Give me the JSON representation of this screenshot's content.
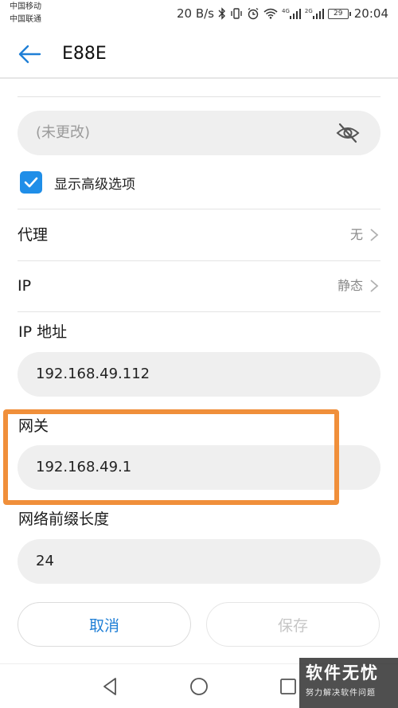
{
  "status_bar": {
    "carrier_1": "中国移动",
    "carrier_2": "中国联通",
    "net_speed": "20 B/s",
    "net_4g": "4G",
    "net_2g": "2G",
    "battery": "29",
    "time": "20:04"
  },
  "app_bar": {
    "title": "E88E"
  },
  "password": {
    "placeholder": "(未更改)"
  },
  "advanced": {
    "label": "显示高级选项",
    "checked": true
  },
  "proxy": {
    "label": "代理",
    "value": "无"
  },
  "ip_mode": {
    "label": "IP",
    "value": "静态"
  },
  "ip_address": {
    "label": "IP 地址",
    "value": "192.168.49.112"
  },
  "gateway": {
    "label": "网关",
    "value": "192.168.49.1"
  },
  "prefix_length": {
    "label": "网络前缀长度",
    "value": "24"
  },
  "actions": {
    "cancel": "取消",
    "save": "保存"
  },
  "watermark": {
    "title": "软件无忧",
    "subtitle": "努力解决软件问题"
  },
  "colors": {
    "accent": "#1f8ee8",
    "highlight": "#f08f3a",
    "field_bg": "#efefef"
  }
}
